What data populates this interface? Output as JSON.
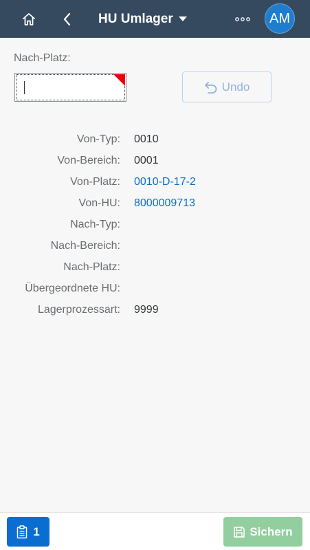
{
  "header": {
    "title": "HU Umlager",
    "avatar_initials": "AM",
    "home_icon": "home-icon",
    "back_icon": "back-icon",
    "more_icon": "more-icon",
    "colors": {
      "bar": "#354a5f",
      "avatar": "#1e7dcf"
    }
  },
  "form": {
    "field_label": "Nach-Platz:",
    "field_value": "",
    "undo_label": "Undo",
    "error_color": "#e8000b"
  },
  "details": [
    {
      "label": "Von-Typ:",
      "value": "0010",
      "link": false
    },
    {
      "label": "Von-Bereich:",
      "value": "0001",
      "link": false
    },
    {
      "label": "Von-Platz:",
      "value": "0010-D-17-2",
      "link": true
    },
    {
      "label": "Von-HU:",
      "value": "8000009713",
      "link": true
    },
    {
      "label": "Nach-Typ:",
      "value": "",
      "link": false
    },
    {
      "label": "Nach-Bereich:",
      "value": "",
      "link": false
    },
    {
      "label": "Nach-Platz:",
      "value": "",
      "link": false
    },
    {
      "label": "Übergeordnete HU:",
      "value": "",
      "link": false
    },
    {
      "label": "Lagerprozessart:",
      "value": "9999",
      "link": false
    }
  ],
  "footer": {
    "tasks_count": "1",
    "tasks_icon": "clipboard-icon",
    "save_label": "Sichern",
    "save_icon": "save-icon",
    "colors": {
      "tasks": "#0a6ed1",
      "save": "#93ce9f"
    }
  }
}
